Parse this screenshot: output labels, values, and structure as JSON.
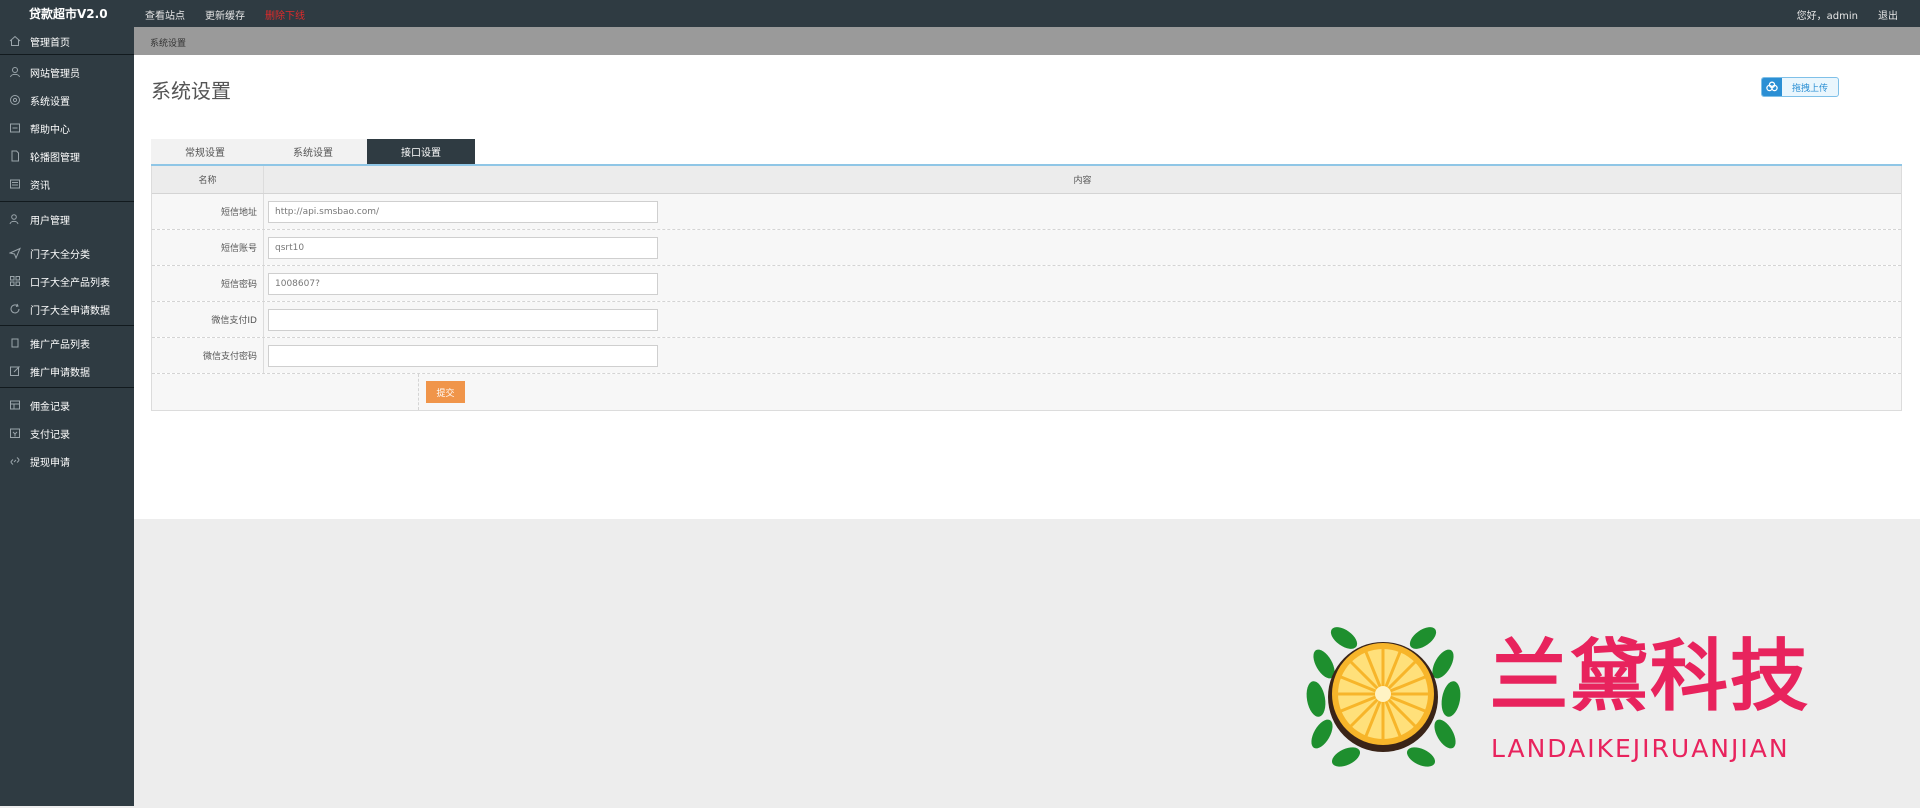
{
  "topbar": {
    "brand": "贷款超市V2.0",
    "nav": [
      "查看站点",
      "更新缓存",
      "删除下线"
    ],
    "user": "您好，admin",
    "logout": "退出"
  },
  "sidebar": {
    "items": [
      {
        "label": "管理首页",
        "icon": "home-icon"
      },
      {
        "label": "网站管理员",
        "icon": "user-icon"
      },
      {
        "label": "系统设置",
        "icon": "gear-icon"
      },
      {
        "label": "帮助中心",
        "icon": "help-icon"
      },
      {
        "label": "轮播图管理",
        "icon": "file-icon"
      },
      {
        "label": "资讯",
        "icon": "news-icon"
      },
      {
        "label": "用户管理",
        "icon": "users-icon"
      },
      {
        "label": "门子大全分类",
        "icon": "send-icon"
      },
      {
        "label": "口子大全产品列表",
        "icon": "grid-icon"
      },
      {
        "label": "门子大全申请数据",
        "icon": "refresh-icon"
      },
      {
        "label": "推广产品列表",
        "icon": "square-icon"
      },
      {
        "label": "推广申请数据",
        "icon": "edit-icon"
      },
      {
        "label": "佣金记录",
        "icon": "table-icon"
      },
      {
        "label": "支付记录",
        "icon": "pay-icon"
      },
      {
        "label": "提现申请",
        "icon": "link-icon"
      }
    ]
  },
  "breadcrumb": "系统设置",
  "page": {
    "title": "系统设置",
    "upload_label": "拖拽上传"
  },
  "tabs": [
    {
      "label": "常规设置",
      "active": false
    },
    {
      "label": "系统设置",
      "active": false
    },
    {
      "label": "接口设置",
      "active": true
    }
  ],
  "table": {
    "headers": {
      "name": "名称",
      "content": "内容"
    },
    "fields": [
      {
        "label": "短信地址",
        "value": "http://api.smsbao.com/"
      },
      {
        "label": "短信账号",
        "value": "qsrt10"
      },
      {
        "label": "短信密码",
        "value": "1008607?"
      },
      {
        "label": "微信支付ID",
        "value": ""
      },
      {
        "label": "微信支付密码",
        "value": ""
      }
    ],
    "submit_label": "提交"
  },
  "watermark": {
    "title": "兰黛科技",
    "subtitle": "LANDAIKEJIRUANJIAN"
  },
  "colors": {
    "dark": "#2f3b42",
    "accent_orange": "#f0954a",
    "warn_red": "#e02a2a",
    "watermark_pink": "#e8235d"
  }
}
